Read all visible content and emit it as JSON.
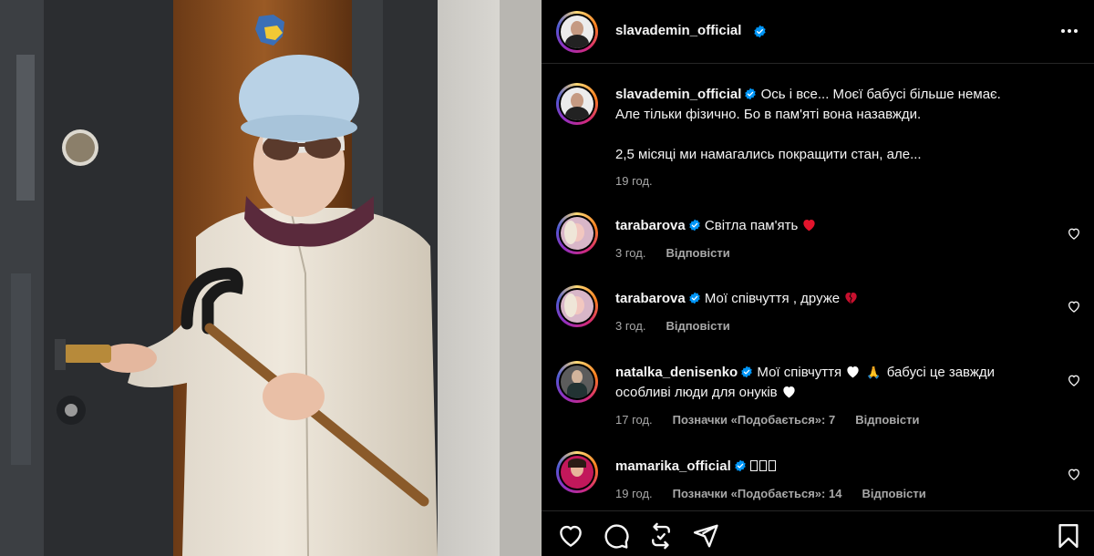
{
  "post": {
    "author": "slavademin_official",
    "caption_lines": [
      "Ось і все... Моєї бабусі більше немає.",
      "Але тільки фізично. Бо в пам'яті вона назавжди.",
      "2,5 місяці ми намагались покращити стан, але..."
    ],
    "caption_time": "19 год."
  },
  "comments": [
    {
      "user": "tarabarova",
      "text": "Світла пам'ять",
      "emoji": "red-heart-icon",
      "time": "3 год.",
      "likes": "",
      "reply": "Відповісти"
    },
    {
      "user": "tarabarova",
      "text": "Мої співчуття , друже",
      "emoji": "broken-heart-icon",
      "time": "3 год.",
      "likes": "",
      "reply": "Відповісти"
    },
    {
      "user": "natalka_denisenko",
      "text": "Мої співчуття",
      "text2": "бабусі це завжди",
      "text3": "особливі люди для онуків",
      "emoji": "white-heart-icon",
      "time": "17 год.",
      "likes": "Позначки «Подобається»: 7",
      "reply": "Відповісти"
    },
    {
      "user": "mamarika_official",
      "text": "",
      "emoji": "",
      "time": "19 год.",
      "likes": "Позначки «Подобається»: 14",
      "reply": "Відповісти"
    }
  ],
  "icons": {
    "more": "more-horizontal-icon",
    "verified": "verified-badge-icon",
    "like": "heart-outline-icon",
    "comment": "comment-icon",
    "repost": "repost-icon",
    "share": "send-icon",
    "save": "bookmark-icon"
  },
  "colors": {
    "background": "#000000",
    "text": "#f5f5f5",
    "muted": "#a8a8a8",
    "verified": "#0095f6",
    "heart_red": "#ff3040"
  }
}
